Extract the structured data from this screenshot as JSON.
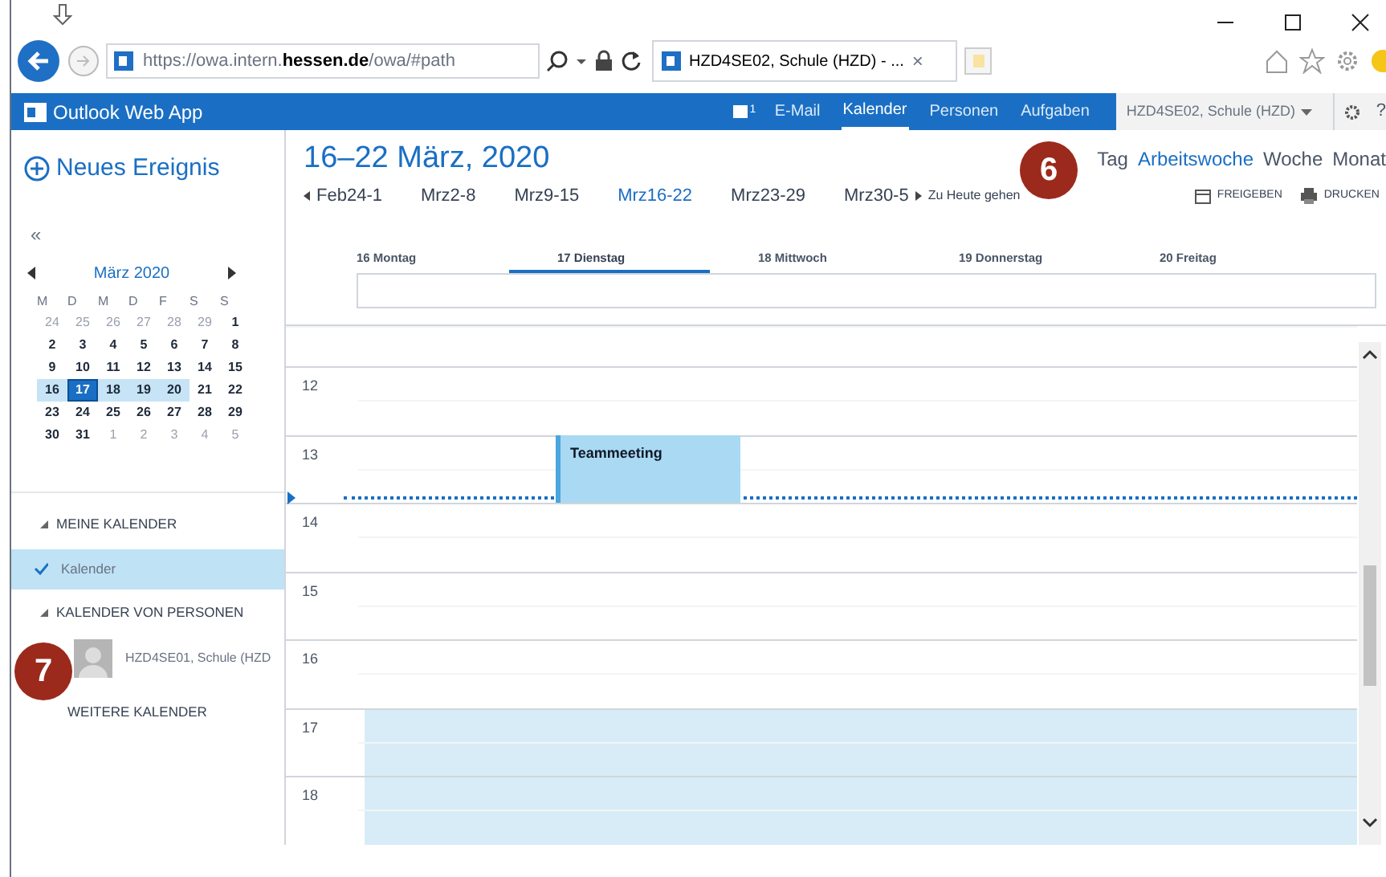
{
  "browser": {
    "address": "https://owa.intern.**hessen.de**/owa/#path",
    "tab_title": "HZD4SE02, Schule (HZD) - ...",
    "tab_close": "×"
  },
  "app_bar": {
    "title": "Outlook Web App",
    "notification_count": "1",
    "nav": [
      {
        "label": "E-Mail",
        "selected": false
      },
      {
        "label": "Kalender",
        "selected": true
      },
      {
        "label": "Personen",
        "selected": false
      },
      {
        "label": "Aufgaben",
        "selected": false
      }
    ],
    "account": "HZD4SE02, Schule (HZD)",
    "help": "?"
  },
  "sidebar": {
    "new_event": "Neues Ereignis",
    "collapse": "«",
    "mini_calendar": {
      "month": "März 2020",
      "weekdays": [
        "M",
        "D",
        "M",
        "D",
        "F",
        "S",
        "S"
      ],
      "weeks": [
        {
          "days": [
            {
              "label": "24",
              "outside_month": true,
              "in_week": false,
              "selected": false
            },
            {
              "label": "25",
              "outside_month": true,
              "in_week": false,
              "selected": false
            },
            {
              "label": "26",
              "outside_month": true,
              "in_week": false,
              "selected": false
            },
            {
              "label": "27",
              "outside_month": true,
              "in_week": false,
              "selected": false
            },
            {
              "label": "28",
              "outside_month": true,
              "in_week": false,
              "selected": false
            },
            {
              "label": "29",
              "outside_month": true,
              "in_week": false,
              "selected": false
            },
            {
              "label": "1",
              "outside_month": false,
              "in_week": false,
              "selected": false
            }
          ]
        },
        {
          "days": [
            {
              "label": "2",
              "outside_month": false,
              "in_week": false,
              "selected": false
            },
            {
              "label": "3",
              "outside_month": false,
              "in_week": false,
              "selected": false
            },
            {
              "label": "4",
              "outside_month": false,
              "in_week": false,
              "selected": false
            },
            {
              "label": "5",
              "outside_month": false,
              "in_week": false,
              "selected": false
            },
            {
              "label": "6",
              "outside_month": false,
              "in_week": false,
              "selected": false
            },
            {
              "label": "7",
              "outside_month": false,
              "in_week": false,
              "selected": false
            },
            {
              "label": "8",
              "outside_month": false,
              "in_week": false,
              "selected": false
            }
          ]
        },
        {
          "days": [
            {
              "label": "9",
              "outside_month": false,
              "in_week": false,
              "selected": false
            },
            {
              "label": "10",
              "outside_month": false,
              "in_week": false,
              "selected": false
            },
            {
              "label": "11",
              "outside_month": false,
              "in_week": false,
              "selected": false
            },
            {
              "label": "12",
              "outside_month": false,
              "in_week": false,
              "selected": false
            },
            {
              "label": "13",
              "outside_month": false,
              "in_week": false,
              "selected": false
            },
            {
              "label": "14",
              "outside_month": false,
              "in_week": false,
              "selected": false
            },
            {
              "label": "15",
              "outside_month": false,
              "in_week": false,
              "selected": false
            }
          ]
        },
        {
          "days": [
            {
              "label": "16",
              "outside_month": false,
              "in_week": true,
              "selected": false
            },
            {
              "label": "17",
              "outside_month": false,
              "in_week": true,
              "selected": true
            },
            {
              "label": "18",
              "outside_month": false,
              "in_week": true,
              "selected": false
            },
            {
              "label": "19",
              "outside_month": false,
              "in_week": true,
              "selected": false
            },
            {
              "label": "20",
              "outside_month": false,
              "in_week": true,
              "selected": false
            },
            {
              "label": "21",
              "outside_month": false,
              "in_week": false,
              "selected": false
            },
            {
              "label": "22",
              "outside_month": false,
              "in_week": false,
              "selected": false
            }
          ]
        },
        {
          "days": [
            {
              "label": "23",
              "outside_month": false,
              "in_week": false,
              "selected": false
            },
            {
              "label": "24",
              "outside_month": false,
              "in_week": false,
              "selected": false
            },
            {
              "label": "25",
              "outside_month": false,
              "in_week": false,
              "selected": false
            },
            {
              "label": "26",
              "outside_month": false,
              "in_week": false,
              "selected": false
            },
            {
              "label": "27",
              "outside_month": false,
              "in_week": false,
              "selected": false
            },
            {
              "label": "28",
              "outside_month": false,
              "in_week": false,
              "selected": false
            },
            {
              "label": "29",
              "outside_month": false,
              "in_week": false,
              "selected": false
            }
          ]
        },
        {
          "days": [
            {
              "label": "30",
              "outside_month": false,
              "in_week": false,
              "selected": false
            },
            {
              "label": "31",
              "outside_month": false,
              "in_week": false,
              "selected": false
            },
            {
              "label": "1",
              "outside_month": true,
              "in_week": false,
              "selected": false
            },
            {
              "label": "2",
              "outside_month": true,
              "in_week": false,
              "selected": false
            },
            {
              "label": "3",
              "outside_month": true,
              "in_week": false,
              "selected": false
            },
            {
              "label": "4",
              "outside_month": true,
              "in_week": false,
              "selected": false
            },
            {
              "label": "5",
              "outside_month": true,
              "in_week": false,
              "selected": false
            }
          ]
        }
      ]
    },
    "items": [
      {
        "kind": "section",
        "label": "MEINE KALENDER"
      },
      {
        "kind": "calendar",
        "label": "Kalender",
        "selected": true
      },
      {
        "kind": "section",
        "label": "KALENDER VON PERSONEN"
      },
      {
        "kind": "person",
        "label": "HZD4SE01, Schule (HZD"
      },
      {
        "kind": "link",
        "label": "WEITERE KALENDER"
      }
    ]
  },
  "main": {
    "title": "16–22 März, 2020",
    "views": [
      {
        "label": "Tag",
        "selected": false
      },
      {
        "label": "Arbeitswoche",
        "selected": true
      },
      {
        "label": "Woche",
        "selected": false
      },
      {
        "label": "Monat",
        "selected": false
      }
    ],
    "week_nav": [
      {
        "label": "Feb24-1",
        "selected": false
      },
      {
        "label": "Mrz2-8",
        "selected": false
      },
      {
        "label": "Mrz9-15",
        "selected": false
      },
      {
        "label": "Mrz16-22",
        "selected": true
      },
      {
        "label": "Mrz23-29",
        "selected": false
      },
      {
        "label": "Mrz30-5",
        "selected": false
      }
    ],
    "today_link": "Zu Heute gehen",
    "actions": [
      {
        "kind": "share",
        "label": "FREIGEBEN"
      },
      {
        "kind": "print",
        "label": "DRUCKEN"
      }
    ],
    "days": [
      {
        "label": "16 Montag",
        "selected": false
      },
      {
        "label": "17 Dienstag",
        "selected": true,
        "events": [
          {
            "title": "Teammeeting"
          }
        ]
      },
      {
        "label": "18 Mittwoch",
        "selected": false
      },
      {
        "label": "19 Donnerstag",
        "selected": false
      },
      {
        "label": "20 Freitag",
        "selected": false
      }
    ],
    "hours": [
      "12",
      "13",
      "14",
      "15",
      "16",
      "17",
      "18"
    ]
  },
  "callouts": [
    {
      "label": "6"
    },
    {
      "label": "7"
    }
  ]
}
